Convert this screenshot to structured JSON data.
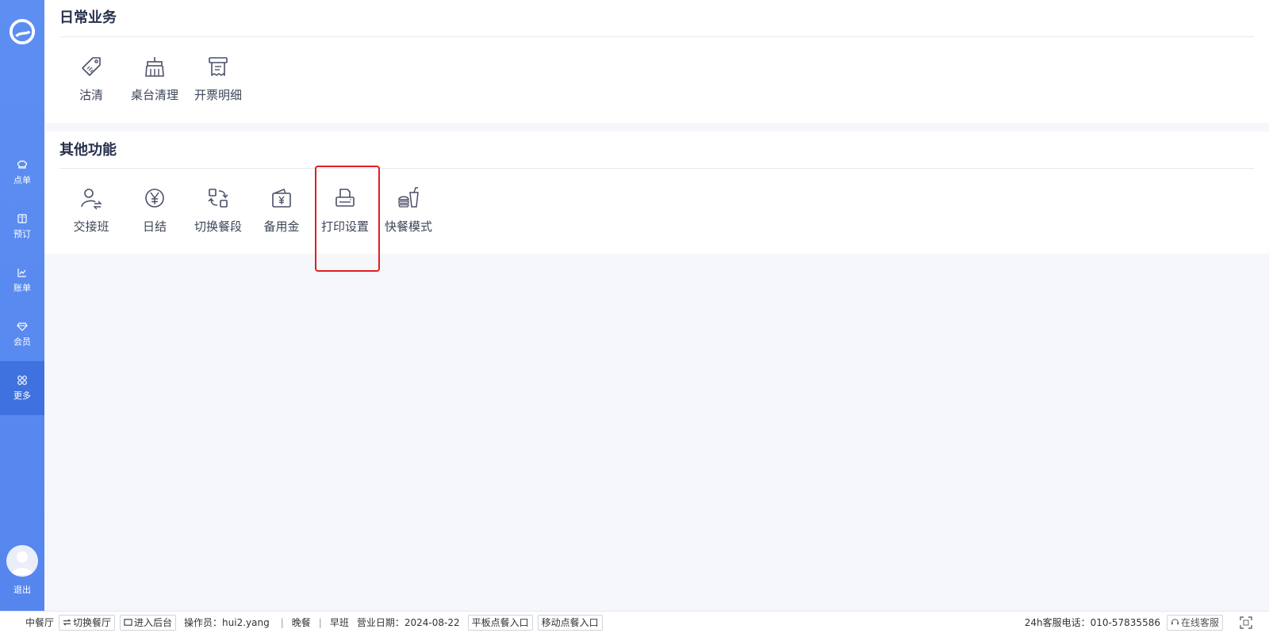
{
  "sidebar": {
    "items": [
      {
        "label": "点单",
        "icon": "chef-hat-icon"
      },
      {
        "label": "预订",
        "icon": "book-icon"
      },
      {
        "label": "账单",
        "icon": "chart-icon"
      },
      {
        "label": "会员",
        "icon": "diamond-icon"
      },
      {
        "label": "更多",
        "icon": "grid-icon",
        "active": true
      }
    ],
    "logout": "退出"
  },
  "sections": [
    {
      "title": "日常业务",
      "tiles": [
        {
          "label": "沽清",
          "icon": "tag-icon"
        },
        {
          "label": "桌台清理",
          "icon": "broom-icon"
        },
        {
          "label": "开票明细",
          "icon": "receipt-icon"
        }
      ]
    },
    {
      "title": "其他功能",
      "tiles": [
        {
          "label": "交接班",
          "icon": "shift-handover-icon"
        },
        {
          "label": "日结",
          "icon": "yen-circle-icon"
        },
        {
          "label": "切换餐段",
          "icon": "switch-icon"
        },
        {
          "label": "备用金",
          "icon": "wallet-yen-icon"
        },
        {
          "label": "打印设置",
          "icon": "printer-icon"
        },
        {
          "label": "快餐模式",
          "icon": "fast-food-icon"
        }
      ]
    }
  ],
  "footer": {
    "restaurant": "中餐厅",
    "switch_restaurant": "切换餐厅",
    "enter_backend": "进入后台",
    "operator": "操作员：hui2.yang",
    "meal_period": "晚餐",
    "shift": "早班",
    "business_date": "营业日期：2024-08-22",
    "tablet_entry": "平板点餐入口",
    "mobile_entry": "移动点餐入口",
    "hotline": "24h客服电话：010-57835586",
    "online_service": "在线客服"
  },
  "colors": {
    "sidebar": "#5b8cf0",
    "sidebar_active": "#3f71df",
    "highlight": "#e01f1f"
  }
}
